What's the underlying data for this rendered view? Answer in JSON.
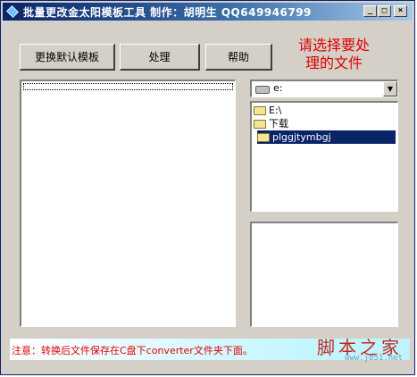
{
  "window": {
    "title": "批量更改金太阳模板工具  制作：胡明生  QQ649946799",
    "controls": {
      "minimize": "_",
      "maximize": "□",
      "close": "×"
    }
  },
  "toolbar": {
    "replace_template_label": "更换默认模板",
    "process_label": "处理",
    "help_label": "帮助"
  },
  "hint": {
    "line1": "请选择要处",
    "line2": "理的文件"
  },
  "drive": {
    "value": "e:",
    "arrow": "▼"
  },
  "folder_tree": [
    {
      "label": "E:\\",
      "selected": false
    },
    {
      "label": "下载",
      "selected": false
    },
    {
      "label": "plggjtymbgj",
      "selected": true
    }
  ],
  "status": {
    "note": "注意：转换后文件保存在C盘下converter文件夹下面。",
    "watermark": "脚本之家",
    "watermark_url": "www.jb51.net"
  },
  "colors": {
    "titlebar": "#0a246a",
    "hint": "#e00000",
    "status_text": "#e00000",
    "selection": "#0a246a"
  }
}
